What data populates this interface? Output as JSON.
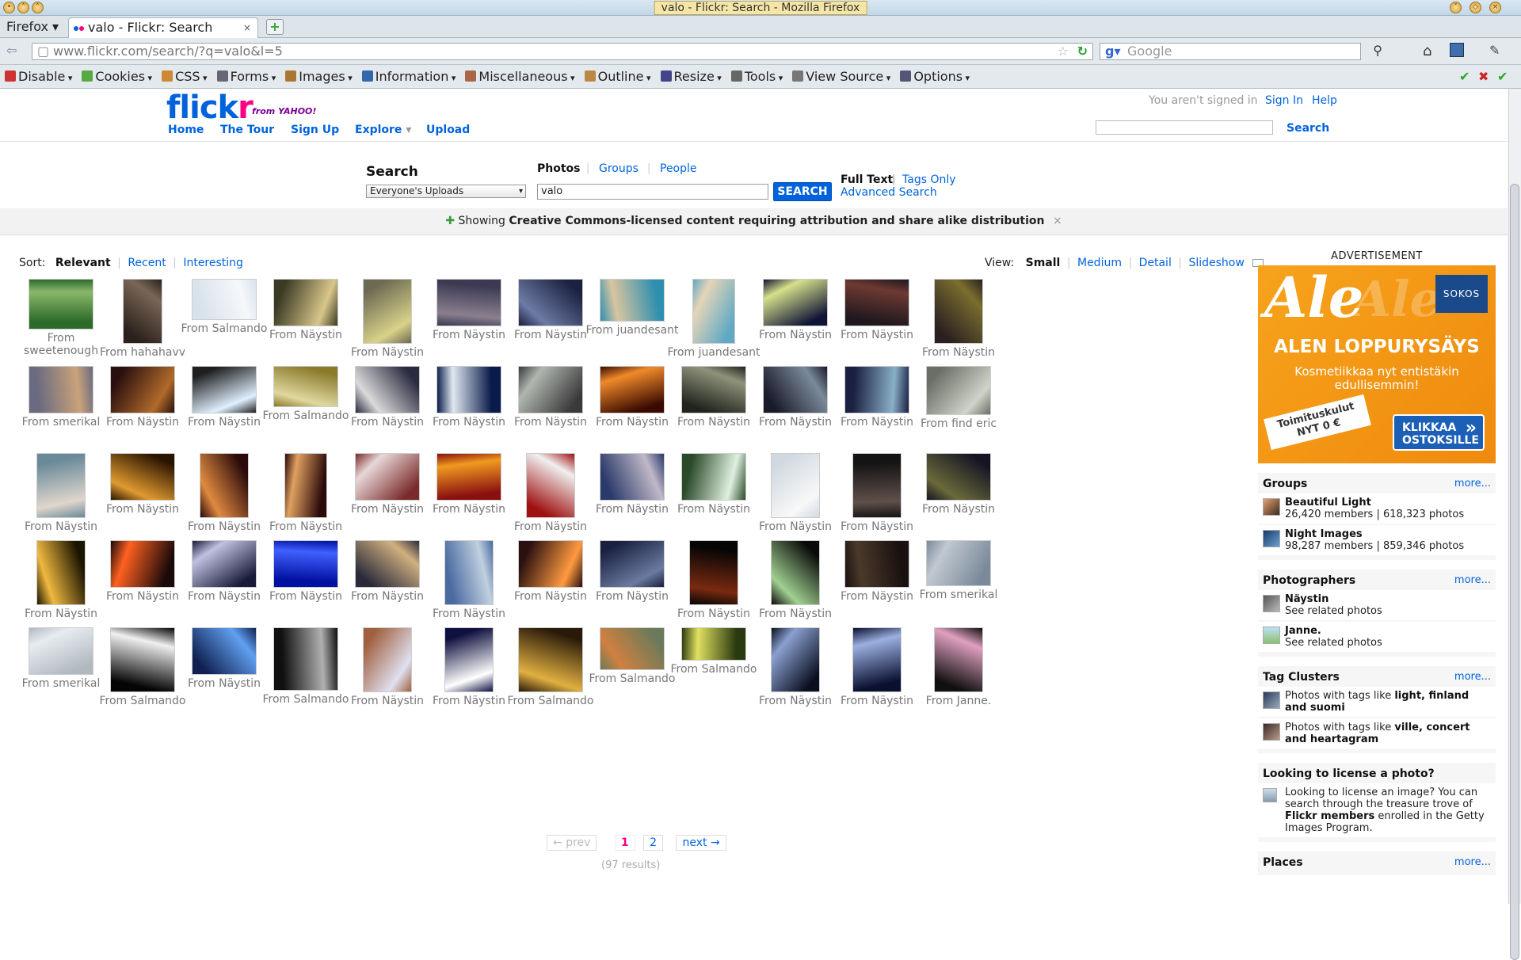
{
  "window": {
    "title": "valo - Flickr: Search - Mozilla Firefox"
  },
  "tabs": {
    "menu": "Firefox",
    "active": "valo - Flickr: Search",
    "close": "×",
    "new": "+"
  },
  "nav": {
    "url": "www.flickr.com/search/?q=valo&l=5",
    "search_placeholder": "Google"
  },
  "devbar": {
    "items": [
      "Disable",
      "Cookies",
      "CSS",
      "Forms",
      "Images",
      "Information",
      "Miscellaneous",
      "Outline",
      "Resize",
      "Tools",
      "View Source",
      "Options"
    ]
  },
  "header": {
    "logo": "flickr",
    "logo_by": "from YAHOO!",
    "nav": [
      "Home",
      "The Tour",
      "Sign Up",
      "Explore",
      "Upload"
    ],
    "signed": "You aren't signed in",
    "signin": "Sign In",
    "help": "Help",
    "search_btn": "Search"
  },
  "search": {
    "title": "Search",
    "scope": "Everyone's Uploads",
    "tabs": [
      "Photos",
      "Groups",
      "People"
    ],
    "query": "valo",
    "button": "SEARCH",
    "full_text": "Full Text",
    "tags_only": "Tags Only",
    "advanced": "Advanced Search"
  },
  "cc": {
    "prefix": "Showing",
    "bold": "Creative Commons-licensed content requiring attribution and share alike distribution",
    "close": "×"
  },
  "sort": {
    "label": "Sort:",
    "options": [
      "Relevant",
      "Recent",
      "Interesting"
    ]
  },
  "view": {
    "label": "View:",
    "options": [
      "Small",
      "Medium",
      "Detail",
      "Slideshow"
    ]
  },
  "photos": [
    [
      "From sweetenough",
      "From hahahavv",
      "From Salmando",
      "From Näystin",
      "From Näystin",
      "From Näystin",
      "From Näystin",
      "From juandesant",
      "From juandesant",
      "From Näystin",
      "From Näystin",
      "From Näystin"
    ],
    [
      "From smerikal",
      "From Näystin",
      "From Näystin",
      "From Salmando",
      "From Näystin",
      "From Näystin",
      "From Näystin",
      "From Näystin",
      "From Näystin",
      "From Näystin",
      "From Näystin",
      "From find eric"
    ],
    [
      "From Näystin",
      "From Näystin",
      "From Näystin",
      "From Näystin",
      "From Näystin",
      "From Näystin",
      "From Näystin",
      "From Näystin",
      "From Näystin",
      "From Näystin",
      "From Näystin",
      "From Näystin"
    ],
    [
      "From Näystin",
      "From Näystin",
      "From Näystin",
      "From Näystin",
      "From Näystin",
      "From Näystin",
      "From Näystin",
      "From Näystin",
      "From Näystin",
      "From Näystin",
      "From Näystin",
      "From smerikal"
    ],
    [
      "From smerikal",
      "From Salmando",
      "From Näystin",
      "From Salmando",
      "From Näystin",
      "From Näystin",
      "From Salmando",
      "From Salmando",
      "From Salmando",
      "From Näystin",
      "From Näystin",
      "From Janne."
    ]
  ],
  "pager": {
    "prev": "← prev",
    "pages": [
      "1",
      "2"
    ],
    "next": "next →",
    "results": "(97 results)"
  },
  "ad": {
    "label": "ADVERTISEMENT",
    "logo": "Ale",
    "brand": "SOKOS",
    "headline": "ALEN LOPPURYSÄYS",
    "sub": "Kosmetiikkaa nyt entistäkin edullisemmin!",
    "ribbon": "Toimituskulut NYT 0 €",
    "button": "KLIKKAA OSTOKSILLE",
    "arrow": "»"
  },
  "groups": {
    "title": "Groups",
    "more": "more...",
    "items": [
      {
        "name": "Beautiful Light",
        "meta": "26,420 members | 618,323 photos"
      },
      {
        "name": "Night Images",
        "meta": "98,287 members | 859,346 photos"
      }
    ]
  },
  "photographers": {
    "title": "Photographers",
    "more": "more...",
    "items": [
      {
        "name": "Näystin",
        "meta": "See related photos"
      },
      {
        "name": "Janne.",
        "meta": "See related photos"
      }
    ]
  },
  "tagclusters": {
    "title": "Tag Clusters",
    "more": "more...",
    "items": [
      {
        "pre": "Photos with tags like ",
        "bold": "light, finland and suomi"
      },
      {
        "pre": "Photos with tags like ",
        "bold": "ville, concert and heartagram"
      }
    ]
  },
  "license": {
    "title": "Looking to license a photo?",
    "pre": "Looking to license an image? You can search through the treasure trove of ",
    "bold": "Flickr members",
    "post": " enrolled in the Getty Images Program."
  },
  "places": {
    "title": "Places",
    "more": "more..."
  }
}
